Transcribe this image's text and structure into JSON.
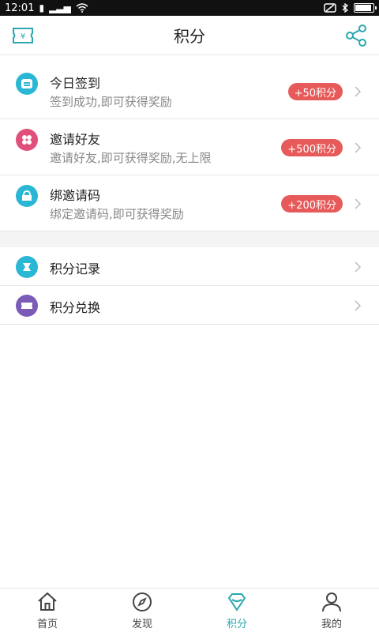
{
  "status_bar": {
    "time": "12:01"
  },
  "header": {
    "title": "积分",
    "left_icon": "ticket-yen-icon",
    "right_icon": "share-icon"
  },
  "tasks": [
    {
      "title": "今日签到",
      "desc": "签到成功,即可获得奖励",
      "badge": "+50积分",
      "icon": "checkin-icon",
      "icon_color": "#2ab7d4"
    },
    {
      "title": "邀请好友",
      "desc": "邀请好友,即可获得奖励,无上限",
      "badge": "+500积分",
      "icon": "invite-icon",
      "icon_color": "#e0507a"
    },
    {
      "title": "绑邀请码",
      "desc": "绑定邀请码,即可获得奖励",
      "badge": "+200积分",
      "icon": "bind-code-icon",
      "icon_color": "#2ab7d4"
    }
  ],
  "menu": [
    {
      "title": "积分记录",
      "icon": "record-icon",
      "icon_color": "#2ab7d4"
    },
    {
      "title": "积分兑换",
      "icon": "exchange-icon",
      "icon_color": "#7b5ab8"
    }
  ],
  "tabs": [
    {
      "label": "首页",
      "icon": "home-icon",
      "active": false
    },
    {
      "label": "发现",
      "icon": "compass-icon",
      "active": false
    },
    {
      "label": "积分",
      "icon": "diamond-icon",
      "active": true
    },
    {
      "label": "我的",
      "icon": "user-icon",
      "active": false
    }
  ],
  "colors": {
    "accent": "#2aa7b0",
    "badge": "#e75a5a"
  }
}
